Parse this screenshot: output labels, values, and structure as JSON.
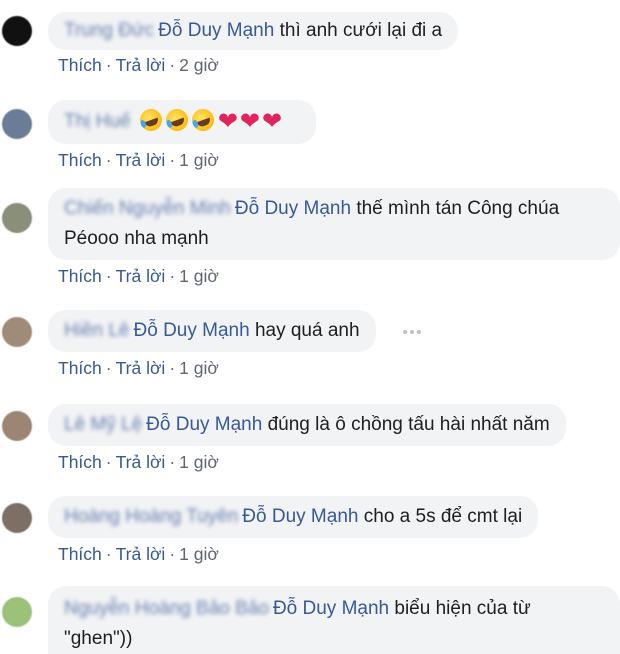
{
  "comments": [
    {
      "author": "Trung Đức",
      "mention": "Đỗ Duy Mạnh",
      "lines": [
        "thì anh cưới lại đi a"
      ],
      "actions": {
        "like": "Thích",
        "reply": "Trả lời",
        "time": "2 giờ"
      },
      "avatar_color": "#111111"
    },
    {
      "author": "Thị Huế",
      "mention": "",
      "lines": [
        ""
      ],
      "emoji": [
        "rolling-on-floor-laughing",
        "rolling-on-floor-laughing",
        "rolling-on-floor-laughing",
        "red-heart",
        "red-heart",
        "red-heart"
      ],
      "heart_glyph": "❤",
      "actions": {
        "like": "Thích",
        "reply": "Trả lời",
        "time": "1 giờ"
      },
      "avatar_color": "#6b7c96"
    },
    {
      "author": "Chiến Nguyễn Minh",
      "mention": "Đỗ Duy Mạnh",
      "lines": [
        "thế mình tán Công chúa",
        "Péooo nha mạnh"
      ],
      "actions": {
        "like": "Thích",
        "reply": "Trả lời",
        "time": "1 giờ"
      },
      "avatar_color": "#8a8f7a"
    },
    {
      "author": "Hiền Lê",
      "mention": "Đỗ Duy Mạnh",
      "lines": [
        "hay quá anh"
      ],
      "actions": {
        "like": "Thích",
        "reply": "Trả lời",
        "time": "1 giờ"
      },
      "avatar_color": "#a08b78"
    },
    {
      "author": "Lê Mỹ Lệ",
      "mention": "Đỗ Duy Mạnh",
      "lines": [
        "đúng là ô chồng tấu hài nhất năm"
      ],
      "actions": {
        "like": "Thích",
        "reply": "Trả lời",
        "time": "1 giờ"
      },
      "avatar_color": "#9c8573"
    },
    {
      "author": "Hoàng Hoàng Tuyên",
      "mention": "Đỗ Duy Mạnh",
      "lines": [
        "cho a 5s để cmt lại"
      ],
      "actions": {
        "like": "Thích",
        "reply": "Trả lời",
        "time": "1 giờ"
      },
      "avatar_color": "#7d6f66"
    },
    {
      "author": "Nguyễn Hoàng Bảo Bảo",
      "mention": "Đỗ Duy Mạnh",
      "lines": [
        "biểu hiện của từ",
        "\"ghen\"))"
      ],
      "actions": null,
      "avatar_color": "#9cc27a"
    }
  ],
  "separator": "·"
}
